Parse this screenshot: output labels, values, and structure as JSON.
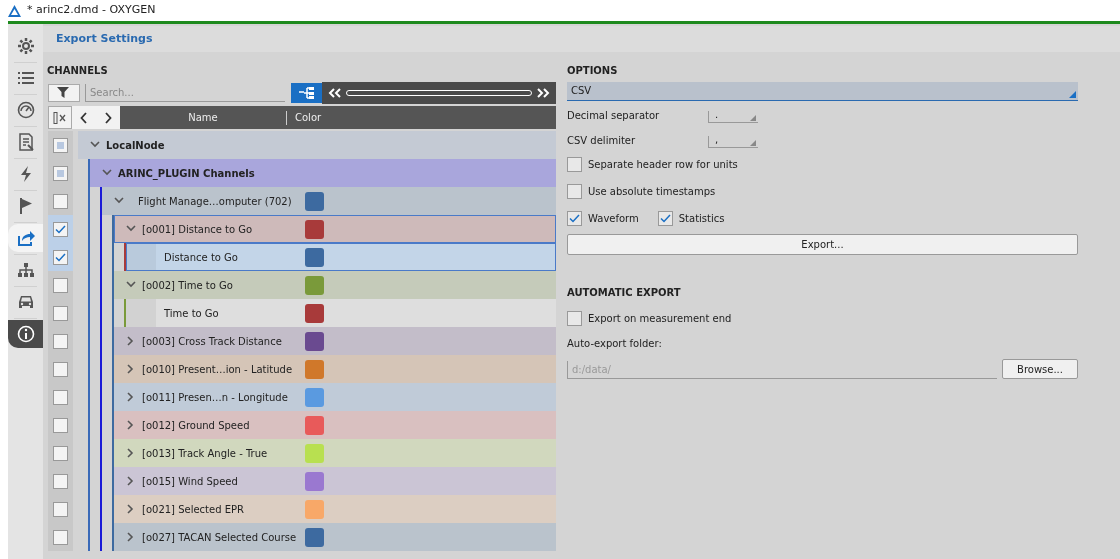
{
  "window": {
    "title": "* arinc2.dmd - OXYGEN"
  },
  "sidebar": {
    "items": [
      {
        "selected": false
      },
      {
        "selected": false
      },
      {
        "selected": false
      },
      {
        "selected": false
      },
      {
        "selected": false
      },
      {
        "selected": false
      },
      {
        "selected": true
      },
      {
        "selected": false
      },
      {
        "selected": false
      },
      {
        "selected": false
      }
    ]
  },
  "page_title": "Export Settings",
  "channels": {
    "heading": "CHANNELS",
    "search": {
      "placeholder": "Search..."
    },
    "columns": [
      "Name",
      "Color"
    ],
    "tree": [
      {
        "label": "LocalNode",
        "checked": false,
        "indeterminate": true,
        "selected": false,
        "expanded": true,
        "children": [
          {
            "label": "ARINC_PLUGIN Channels",
            "checked": false,
            "indeterminate": true,
            "selected": false,
            "expanded": true,
            "children": [
              {
                "label": "Flight Manage…omputer (702)",
                "color": "#3d6aa0",
                "checked": false,
                "selected": false,
                "expanded": true,
                "children": [
                  {
                    "label": "[o001] Distance to Go",
                    "color": "#a83a3a",
                    "checked": true,
                    "selected": true,
                    "expanded": true,
                    "children": [
                      {
                        "label": "Distance to Go",
                        "color": "#3d6aa0",
                        "checked": true,
                        "selected": true
                      }
                    ]
                  },
                  {
                    "label": "[o002] Time to Go",
                    "color": "#7a9a3a",
                    "checked": false,
                    "selected": false,
                    "expanded": true,
                    "children": [
                      {
                        "label": "Time to Go",
                        "color": "#a83a3a",
                        "checked": false,
                        "selected": false
                      }
                    ]
                  },
                  {
                    "label": "[o003] Cross Track Distance",
                    "color": "#6a4a90",
                    "checked": false,
                    "selected": false,
                    "expanded": false
                  },
                  {
                    "label": "[o010] Present…ion - Latitude",
                    "color": "#d0782a",
                    "checked": false,
                    "selected": false,
                    "expanded": false
                  },
                  {
                    "label": "[o011] Presen…n - Longitude",
                    "color": "#5a9ae0",
                    "checked": false,
                    "selected": false,
                    "expanded": false
                  },
                  {
                    "label": "[o012] Ground Speed",
                    "color": "#e85a5a",
                    "checked": false,
                    "selected": false,
                    "expanded": false
                  },
                  {
                    "label": "[o013] Track Angle - True",
                    "color": "#b8e050",
                    "checked": false,
                    "selected": false,
                    "expanded": false
                  },
                  {
                    "label": "[o015] Wind Speed",
                    "color": "#9a78d0",
                    "checked": false,
                    "selected": false,
                    "expanded": false
                  },
                  {
                    "label": "[o021] Selected EPR",
                    "color": "#f8a868",
                    "checked": false,
                    "selected": false,
                    "expanded": false
                  },
                  {
                    "label": "[o027] TACAN Selected Course",
                    "color": "#3d6aa0",
                    "checked": false,
                    "selected": false,
                    "expanded": false
                  }
                ]
              }
            ]
          }
        ]
      }
    ]
  },
  "options": {
    "heading": "OPTIONS",
    "format": "CSV",
    "fields": [
      {
        "label": "Decimal separator",
        "value": "."
      },
      {
        "label": "CSV delimiter",
        "value": ","
      }
    ],
    "checkboxes": [
      [
        {
          "label": "Separate header row for units",
          "checked": false
        }
      ],
      [
        {
          "label": "Use absolute timestamps",
          "checked": false
        }
      ],
      [
        {
          "label": "Waveform",
          "checked": true
        },
        {
          "label": "Statistics",
          "checked": true
        }
      ]
    ],
    "export_button": "Export..."
  },
  "automatic_export": {
    "heading": "AUTOMATIC EXPORT",
    "checkbox": {
      "label": "Export on measurement end",
      "checked": false
    },
    "folder_label": "Auto-export folder:",
    "folder_placeholder": "d:/data/",
    "browse_button": "Browse..."
  }
}
